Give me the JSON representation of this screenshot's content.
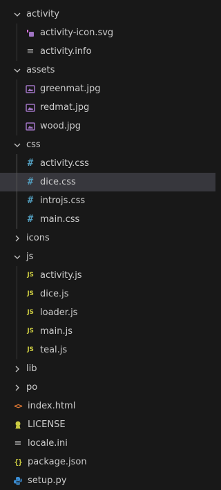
{
  "explorer": {
    "activity_folder": "activity",
    "activity_icon_svg": "activity-icon.svg",
    "activity_info": "activity.info",
    "assets_folder": "assets",
    "greenmat": "greenmat.jpg",
    "redmat": "redmat.jpg",
    "wood": "wood.jpg",
    "css_folder": "css",
    "activity_css": "activity.css",
    "dice_css": "dice.css",
    "introjs_css": "introjs.css",
    "main_css": "main.css",
    "icons_folder": "icons",
    "js_folder": "js",
    "activity_js": "activity.js",
    "dice_js": "dice.js",
    "loader_js": "loader.js",
    "main_js": "main.js",
    "teal_js": "teal.js",
    "lib_folder": "lib",
    "po_folder": "po",
    "index_html": "index.html",
    "license": "LICENSE",
    "locale_ini": "locale.ini",
    "package_json": "package.json",
    "setup_py": "setup.py"
  },
  "icon_glyphs": {
    "js": "JS",
    "hash": "#",
    "braces": "{}",
    "code": "<>",
    "lines": "≡"
  },
  "selected_item": "dice.css",
  "colors": {
    "background": "#181818",
    "selected_row": "#37373d",
    "text": "#cccccc",
    "css_icon": "#519aba",
    "js_icon": "#cbcb41",
    "image_icon": "#a074c4",
    "html_icon": "#e37933",
    "python_icon": "#3b8fd6"
  }
}
